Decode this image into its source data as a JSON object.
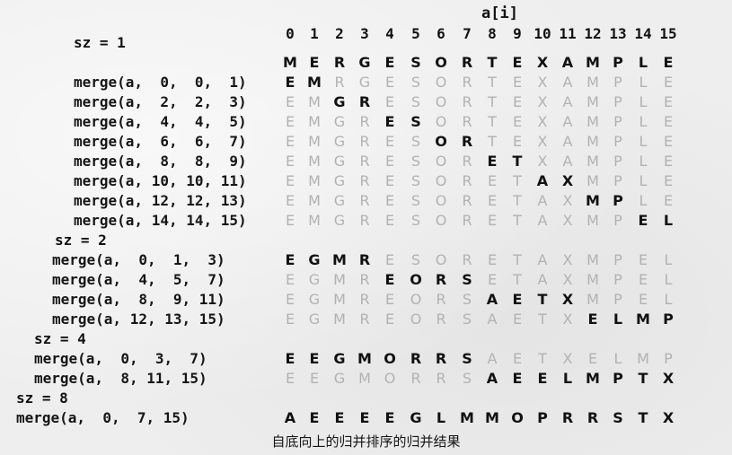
{
  "array_label": "a[i]",
  "indices": [
    "0",
    "1",
    "2",
    "3",
    "4",
    "5",
    "6",
    "7",
    "8",
    "9",
    "10",
    "11",
    "12",
    "13",
    "14",
    "15"
  ],
  "steps": [
    {
      "kind": "sz",
      "label": "sz = 1"
    },
    {
      "kind": "row",
      "label": "",
      "cells": "MERGESORTEXAMPLE",
      "bold": [
        0,
        1,
        2,
        3,
        4,
        5,
        6,
        7,
        8,
        9,
        10,
        11,
        12,
        13,
        14,
        15
      ]
    },
    {
      "kind": "row",
      "label": "merge(a,  0,  0,  1)",
      "cells": "EMRGESORTEXAMPLE",
      "bold": [
        0,
        1
      ]
    },
    {
      "kind": "row",
      "label": "merge(a,  2,  2,  3)",
      "cells": "EMGRESORTEXAMPLE",
      "bold": [
        2,
        3
      ]
    },
    {
      "kind": "row",
      "label": "merge(a,  4,  4,  5)",
      "cells": "EMGRESORTEXAMPLE",
      "bold": [
        4,
        5
      ]
    },
    {
      "kind": "row",
      "label": "merge(a,  6,  6,  7)",
      "cells": "EMGRESORTEXAMPLE",
      "bold": [
        6,
        7
      ]
    },
    {
      "kind": "row",
      "label": "merge(a,  8,  8,  9)",
      "cells": "EMGRESORETXAMPLE",
      "bold": [
        8,
        9
      ]
    },
    {
      "kind": "row",
      "label": "merge(a, 10, 10, 11)",
      "cells": "EMGRESORETAXMPLE",
      "bold": [
        10,
        11
      ]
    },
    {
      "kind": "row",
      "label": "merge(a, 12, 12, 13)",
      "cells": "EMGRESORETAXMPLE",
      "bold": [
        12,
        13
      ]
    },
    {
      "kind": "row",
      "label": "merge(a, 14, 14, 15)",
      "cells": "EMGRESORETAXMPEL",
      "bold": [
        14,
        15
      ]
    },
    {
      "kind": "sz",
      "label": "sz = 2"
    },
    {
      "kind": "row",
      "label": "merge(a,  0,  1,  3)",
      "cells": "EGMRESORETAXMPEL",
      "bold": [
        0,
        1,
        2,
        3
      ]
    },
    {
      "kind": "row",
      "label": "merge(a,  4,  5,  7)",
      "cells": "EGMREORSETAXMPEL",
      "bold": [
        4,
        5,
        6,
        7
      ]
    },
    {
      "kind": "row",
      "label": "merge(a,  8,  9, 11)",
      "cells": "EGMREORSAETXMPEL",
      "bold": [
        8,
        9,
        10,
        11
      ]
    },
    {
      "kind": "row",
      "label": "merge(a, 12, 13, 15)",
      "cells": "EGMREORSAETXELMP",
      "bold": [
        12,
        13,
        14,
        15
      ]
    },
    {
      "kind": "sz",
      "label": "sz = 4"
    },
    {
      "kind": "row",
      "label": "merge(a,  0,  3,  7)",
      "cells": "EEGMORRSAETXELMP",
      "bold": [
        0,
        1,
        2,
        3,
        4,
        5,
        6,
        7
      ]
    },
    {
      "kind": "row",
      "label": "merge(a,  8, 11, 15)",
      "cells": "EEGMORRSAEELMPTX",
      "bold": [
        8,
        9,
        10,
        11,
        12,
        13,
        14,
        15
      ]
    },
    {
      "kind": "sz",
      "label": "sz = 8"
    },
    {
      "kind": "row",
      "label": "merge(a,  0,  7, 15)",
      "cells": "AEEEEGLMMOPRRSTX",
      "bold": [
        0,
        1,
        2,
        3,
        4,
        5,
        6,
        7,
        8,
        9,
        10,
        11,
        12,
        13,
        14,
        15
      ]
    }
  ],
  "caption": "自底向上的归并排序的归并结果"
}
